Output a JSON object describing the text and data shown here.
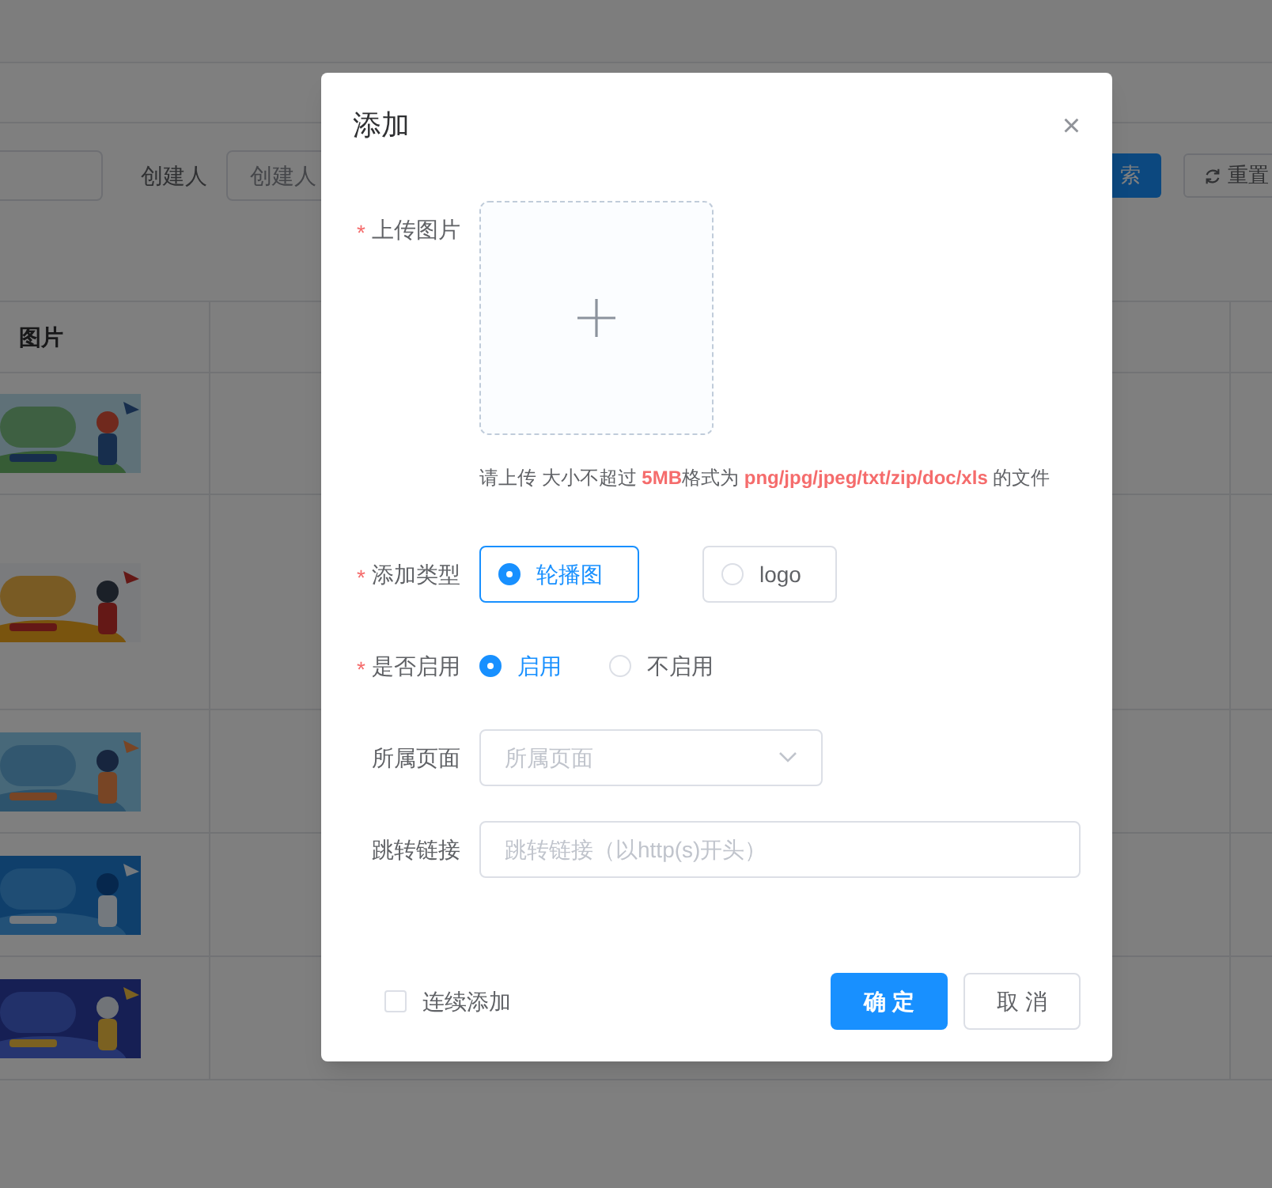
{
  "background": {
    "filter": {
      "label": "创建人",
      "placeholder": "创建人"
    },
    "search_button": "索",
    "reset_button": "重置",
    "table": {
      "columns": [
        "图片"
      ],
      "rows": [
        {
          "image": {
            "kind": "picture"
          }
        },
        {
          "image": {
            "kind": "picture"
          }
        },
        {
          "image": {
            "kind": "picture"
          }
        },
        {
          "image": {
            "kind": "picture"
          }
        },
        {
          "image": {
            "kind": "picture"
          }
        }
      ]
    }
  },
  "dialog": {
    "title": "添加",
    "close": "×",
    "fields": [
      {
        "kind": "upload",
        "label": "上传图片",
        "mark": "*",
        "hint": [
          {
            "text": "请上传 大小不超过 ",
            "highlight": false
          },
          {
            "text": "5MB",
            "highlight": true
          },
          {
            "text": "格式为 ",
            "highlight": false
          },
          {
            "text": "png/jpg/jpeg/txt/zip/doc/xls",
            "highlight": true
          },
          {
            "text": " 的文件",
            "highlight": false
          }
        ]
      },
      {
        "kind": "radio_buttons",
        "label": "添加类型",
        "mark": "*",
        "options": [
          {
            "label": "轮播图",
            "selected": true
          },
          {
            "label": "logo",
            "selected": false
          }
        ]
      },
      {
        "kind": "radio",
        "label": "是否启用",
        "mark": "*",
        "options": [
          {
            "label": "启用",
            "selected": true
          },
          {
            "label": "不启用",
            "selected": false
          }
        ]
      },
      {
        "kind": "select",
        "label": "所属页面",
        "placeholder": "所属页面"
      },
      {
        "kind": "text",
        "label": "跳转链接",
        "placeholder": "跳转链接（以http(s)开头）"
      }
    ],
    "continuous": {
      "label": "连续添加",
      "checked": false
    },
    "ok": "确 定",
    "cancel": "取 消"
  }
}
